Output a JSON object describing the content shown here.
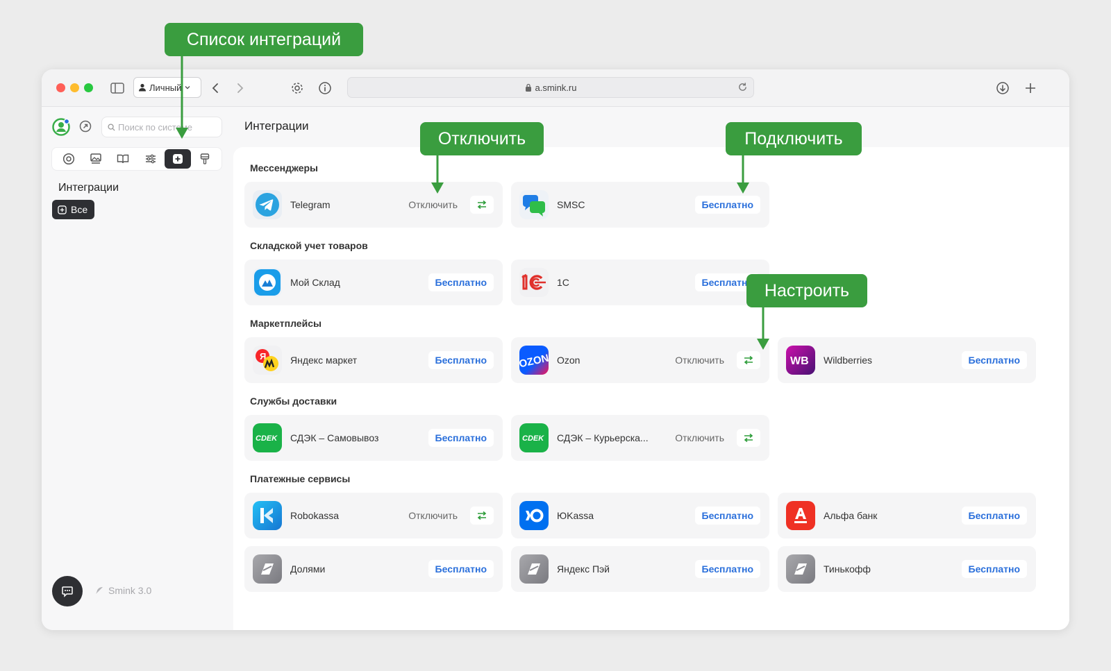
{
  "browser": {
    "profile_label": "Личный",
    "url": "a.smink.ru"
  },
  "sidebar": {
    "search_placeholder": "Поиск по системе",
    "heading": "Интеграции",
    "filter_chip": "Все",
    "version": "Smink 3.0"
  },
  "main": {
    "title": "Интеграции",
    "sections": {
      "messengers": "Мессенджеры",
      "warehouse": "Складской учет товаров",
      "marketplaces": "Маркетплейсы",
      "delivery": "Службы доставки",
      "payments": "Платежные сервисы"
    },
    "labels": {
      "disconnect": "Отключить",
      "free": "Бесплатно"
    },
    "cards": {
      "telegram": "Telegram",
      "smsc": "SMSC",
      "moysklad": "Мой Склад",
      "onec": "1С",
      "yandex_market": "Яндекс маркет",
      "ozon": "Ozon",
      "wildberries": "Wildberries",
      "cdek_pickup": "СДЭК – Самовывоз",
      "cdek_courier": "СДЭК – Курьерска...",
      "robokassa": "Robokassa",
      "yookassa": "ЮKassa",
      "alfa": "Альфа банк",
      "dolyami": "Долями",
      "yandex_pay": "Яндекс Пэй",
      "tinkoff": "Тинькофф"
    }
  },
  "annotations": {
    "integrations_list": "Список интеграций",
    "disconnect": "Отключить",
    "connect": "Подключить",
    "configure": "Настроить"
  },
  "colors": {
    "accent_green": "#3a9d3f",
    "free_blue": "#2a6fdb",
    "dark": "#2e2f33"
  }
}
